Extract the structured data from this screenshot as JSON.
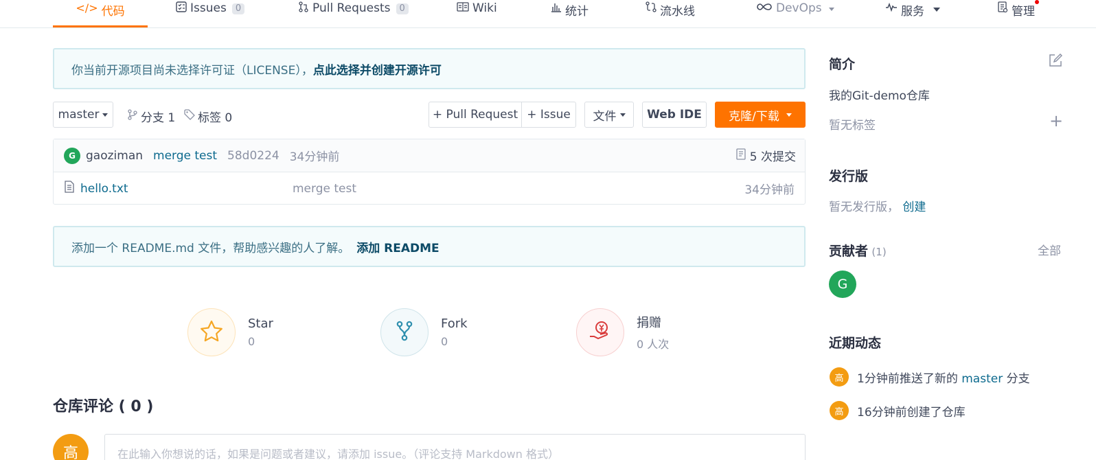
{
  "tabs": [
    {
      "label": "代码",
      "icon": "code-icon",
      "active": true
    },
    {
      "label": "Issues",
      "badge": "0",
      "icon": "issues-icon"
    },
    {
      "label": "Pull Requests",
      "badge": "0",
      "icon": "pull-request-icon"
    },
    {
      "label": "Wiki",
      "icon": "wiki-icon"
    },
    {
      "label": "统计",
      "icon": "stats-icon"
    },
    {
      "label": "流水线",
      "icon": "pipeline-icon"
    },
    {
      "label": "DevOps",
      "icon": "infinity-icon"
    },
    {
      "label": "服务",
      "icon": "pulse-icon"
    },
    {
      "label": "管理",
      "icon": "manage-icon"
    }
  ],
  "license_banner": {
    "text": "你当前开源项目尚未选择许可证（LICENSE），",
    "link": "点此选择并创建开源许可"
  },
  "toolbar": {
    "branch": "master",
    "branches": "分支 1",
    "tags": "标签 0",
    "pull_request": "+ Pull Request",
    "issue": "+ Issue",
    "file": "文件",
    "web_ide": "Web IDE",
    "clone": "克隆/下载"
  },
  "commit": {
    "avatar_letter": "G",
    "author": "gaoziman",
    "message": "merge test",
    "hash": "58d0224",
    "time": "34分钟前",
    "count": "5 次提交"
  },
  "files": [
    {
      "name": "hello.txt",
      "message": "merge test",
      "time": "34分钟前"
    }
  ],
  "readme_banner": {
    "text": "添加一个 README.md 文件，帮助感兴趣的人了解。",
    "link": "添加 README"
  },
  "stats": {
    "star": {
      "label": "Star",
      "value": "0"
    },
    "fork": {
      "label": "Fork",
      "value": "0"
    },
    "donate": {
      "label": "捐赠",
      "value": "0 人次"
    }
  },
  "comments": {
    "title": "仓库评论 ( 0 )",
    "avatar_letter": "高",
    "placeholder": "在此输入你想说的话，如果是问题或者建议，请添加 issue。（评论支持 Markdown 格式）"
  },
  "sidebar": {
    "intro_title": "简介",
    "description": "我的Git-demo仓库",
    "no_tags": "暂无标签",
    "release_title": "发行版",
    "no_release": "暂无发行版，",
    "create_link": "创建",
    "contributors_title": "贡献者",
    "contributors_count": "(1)",
    "all_link": "全部",
    "contributor_letter": "G",
    "activity_title": "近期动态",
    "activity": [
      {
        "avatar": "高",
        "pre": "1分钟前推送了新的 ",
        "link": "master",
        "post": " 分支"
      },
      {
        "avatar": "高",
        "pre": "16分钟前创建了仓库",
        "link": "",
        "post": ""
      }
    ]
  },
  "colors": {
    "accent": "#fe7300",
    "link": "#0d6a8e",
    "green": "#22a65a",
    "activity_avatar": "#f39c12"
  }
}
